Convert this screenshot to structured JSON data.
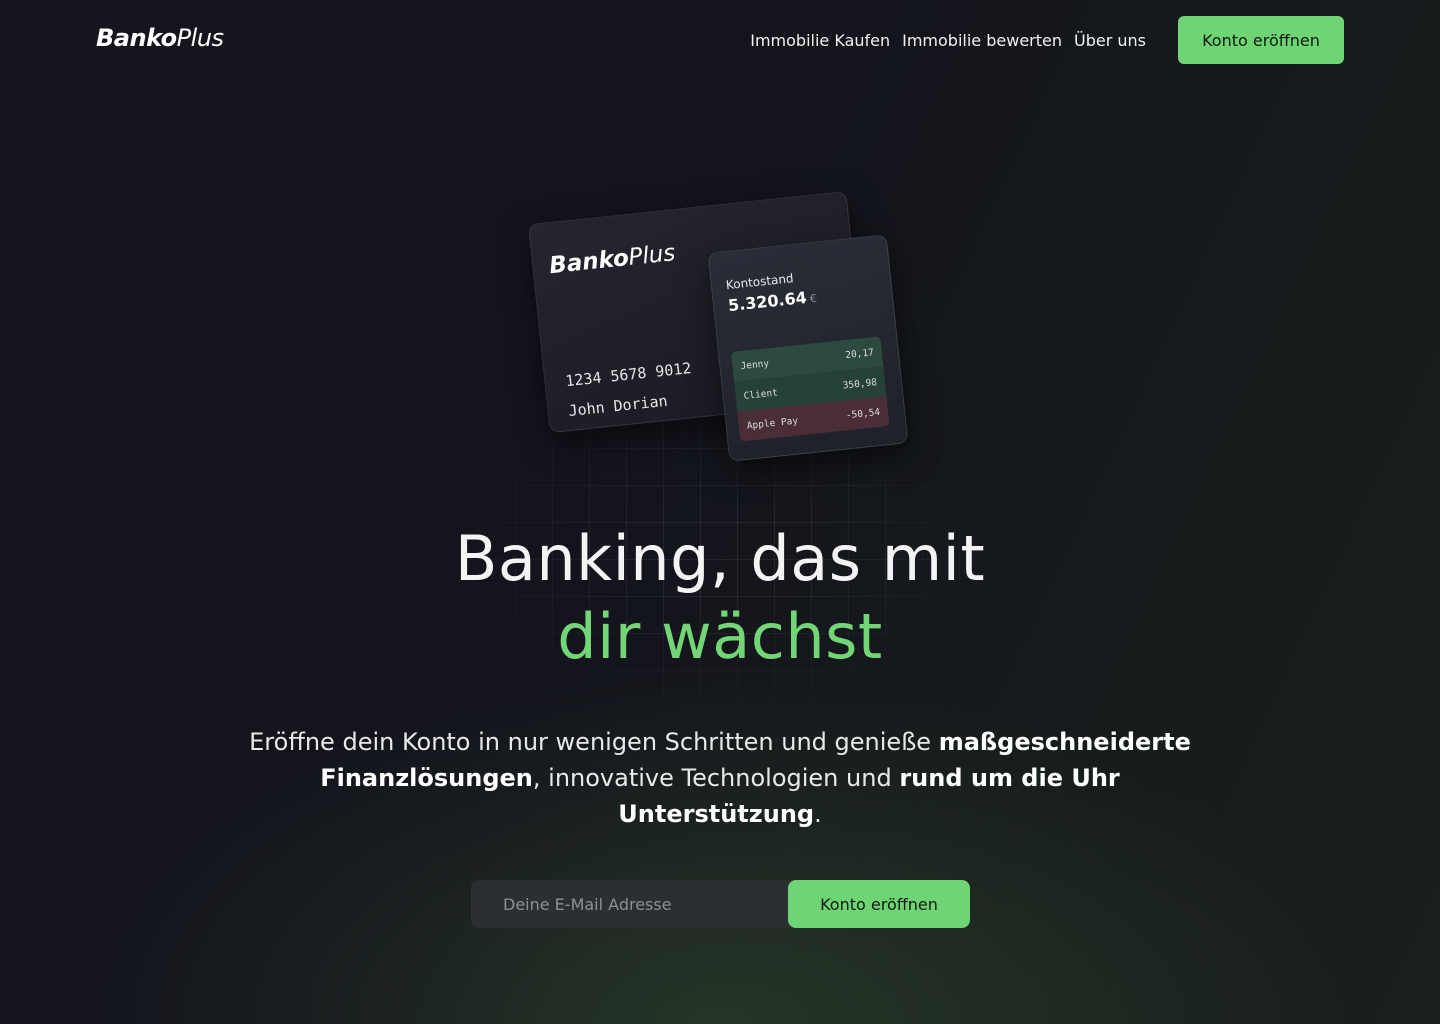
{
  "header": {
    "logo_bold": "Banko",
    "logo_light": "Plus",
    "nav": [
      {
        "label": "Immobilie Kaufen"
      },
      {
        "label": "Immobilie bewerten"
      },
      {
        "label": "Über uns"
      }
    ],
    "cta_label": "Konto eröffnen"
  },
  "card": {
    "logo_bold": "Banko",
    "logo_light": "Plus",
    "number": "1234 5678 9012",
    "holder": "John Dorian"
  },
  "balance": {
    "label": "Kontostand",
    "amount": "5.320.64",
    "currency": "€",
    "transactions": [
      {
        "name": "Jenny",
        "value": "20,17"
      },
      {
        "name": "Client",
        "value": "350,98"
      },
      {
        "name": "Apple Pay",
        "value": "-50,54"
      }
    ]
  },
  "hero": {
    "line1": "Banking, das mit",
    "line2": "dir wächst",
    "subtitle": {
      "p1": "Eröffne dein Konto in nur wenigen Schritten und genieße ",
      "b1": "maßgeschneiderte Finanzlösungen",
      "p2": ", innovative Technologien und ",
      "b2": "rund um die Uhr Unterstützung",
      "p3": "."
    }
  },
  "signup": {
    "placeholder": "Deine E-Mail Adresse",
    "button_label": "Konto eröffnen"
  },
  "colors": {
    "accent": "#6fd474",
    "background": "#14151d"
  }
}
